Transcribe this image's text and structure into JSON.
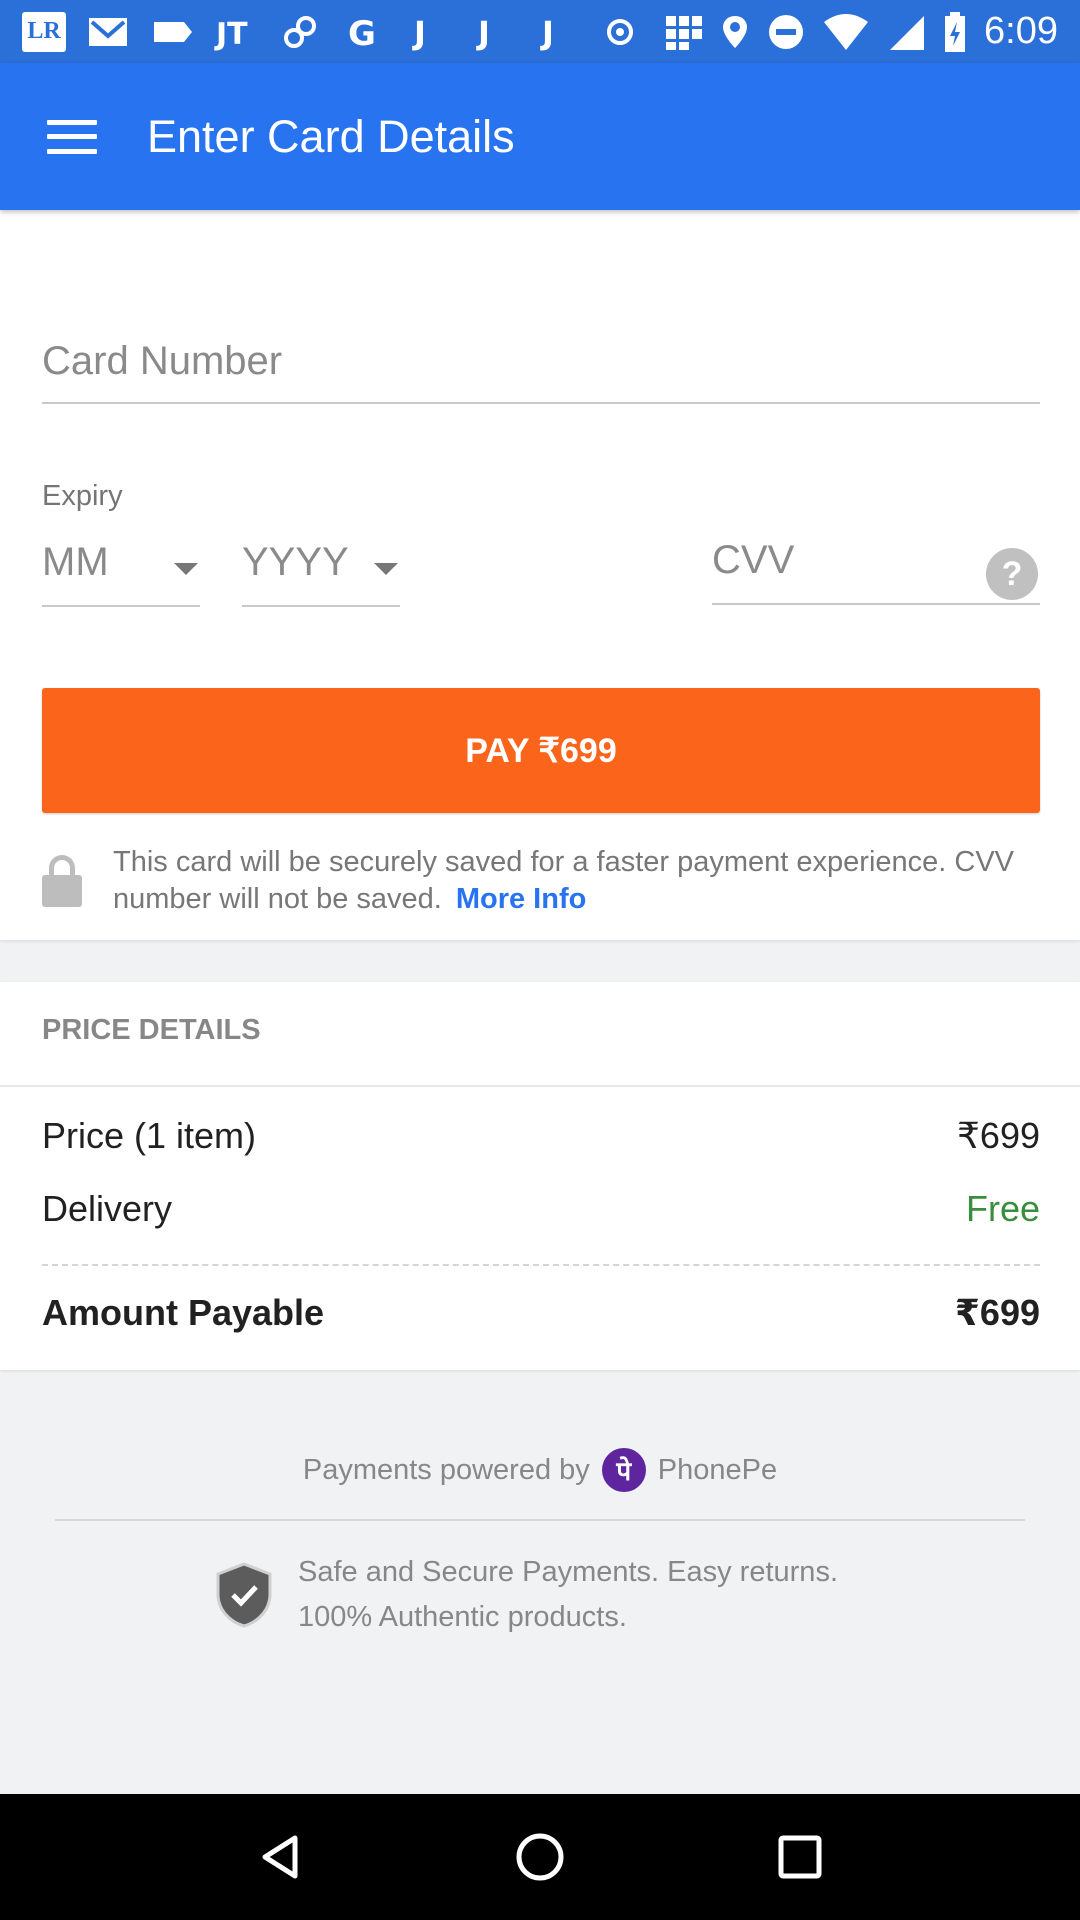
{
  "status_bar": {
    "time": "6:09",
    "icons": [
      "lr-icon",
      "gmail-icon",
      "tag-icon",
      "jt-icon",
      "link-icon",
      "google-icon",
      "j-icon",
      "j-icon",
      "j-icon",
      "record-icon",
      "grid-icon",
      "location-icon",
      "dnd-icon",
      "wifi-icon",
      "signal-icon",
      "battery-icon"
    ],
    "lr_label": "LR"
  },
  "app_bar": {
    "title": "Enter Card Details"
  },
  "card_form": {
    "card_number_placeholder": "Card Number",
    "expiry_label": "Expiry",
    "month_value": "MM",
    "year_value": "YYYY",
    "cvv_placeholder": "CVV",
    "cvv_help": "?",
    "pay_label": "PAY ₹699",
    "secure_text": "This card will be securely saved for a faster payment experience. CVV number will not be saved.",
    "more_info": "More Info"
  },
  "price_details": {
    "heading": "PRICE DETAILS",
    "rows": [
      {
        "label": "Price (1 item)",
        "value": "₹699"
      },
      {
        "label": "Delivery",
        "value": "Free"
      }
    ],
    "total_label": "Amount Payable",
    "total_value": "₹699"
  },
  "footer": {
    "powered_by": "Payments powered by",
    "phonepe_glyph": "पे",
    "phonepe_name": "PhonePe",
    "safe_line1": "Safe and Secure Payments. Easy returns.",
    "safe_line2": "100% Authentic products."
  },
  "colors": {
    "app_bar": "#2874f0",
    "pay_button": "#fb641b",
    "link": "#2874f0",
    "free": "#388e3c",
    "phonepe": "#5f259f"
  }
}
